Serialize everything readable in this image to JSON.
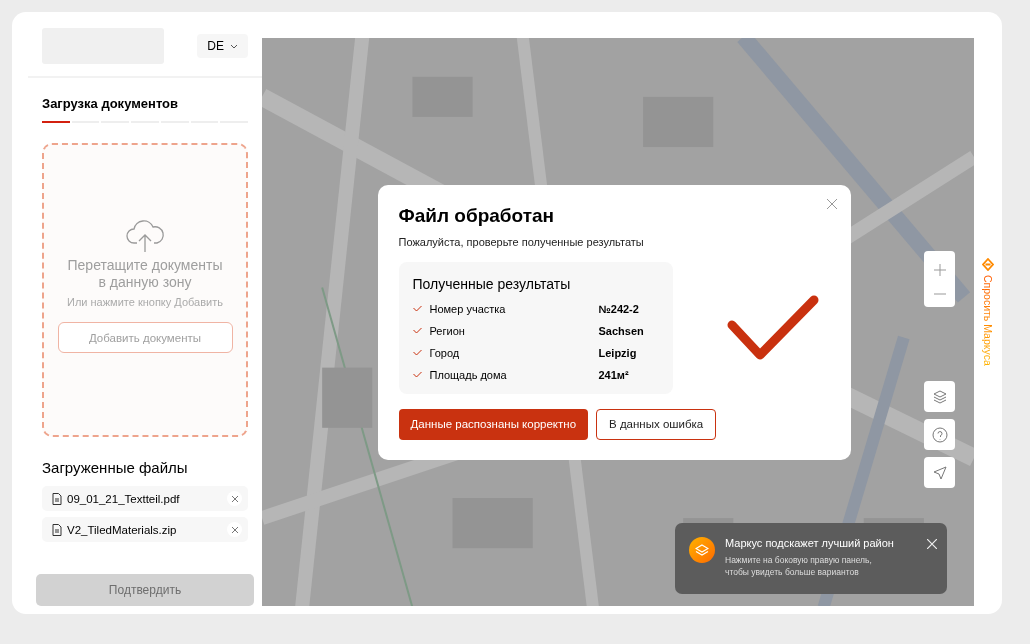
{
  "header": {
    "language": "DE"
  },
  "upload": {
    "title": "Загрузка документов",
    "steps": [
      {
        "selected": true
      },
      {
        "selected": false
      },
      {
        "selected": false
      },
      {
        "selected": false
      },
      {
        "selected": false
      },
      {
        "selected": false
      },
      {
        "selected": false
      }
    ],
    "dropzone": {
      "title": "Перетащите документы в данную зону",
      "hint": "Или нажмите кнопку Добавить",
      "button": "Добавить документы"
    }
  },
  "files": {
    "title": "Загруженные файлы",
    "items": [
      {
        "name": "09_01_21_Textteil.pdf"
      },
      {
        "name": "V2_TiledMaterials.zip"
      }
    ]
  },
  "confirm_button": {
    "label": "Подтвердить",
    "disabled": true
  },
  "dialog": {
    "title": "Файл обработан",
    "subtitle": "Пожалуйста, проверьте полученные результаты",
    "results": {
      "title": "Полученные результаты",
      "rows": [
        {
          "label": "Номер участка",
          "value": "№242-2"
        },
        {
          "label": "Регион",
          "value": "Sachsen"
        },
        {
          "label": "Город",
          "value": "Leipzig"
        },
        {
          "label": "Площадь дома",
          "value": "241м²"
        }
      ]
    },
    "primary_button": "Данные распознаны корректно",
    "secondary_button": "В данных ошибка"
  },
  "toast": {
    "title": "Маркус подскажет лучший район",
    "text": "Нажмите на боковую правую панель, чтобы увидеть больше вариантов"
  },
  "side_tab": {
    "label": "Спросить Маркуса"
  }
}
